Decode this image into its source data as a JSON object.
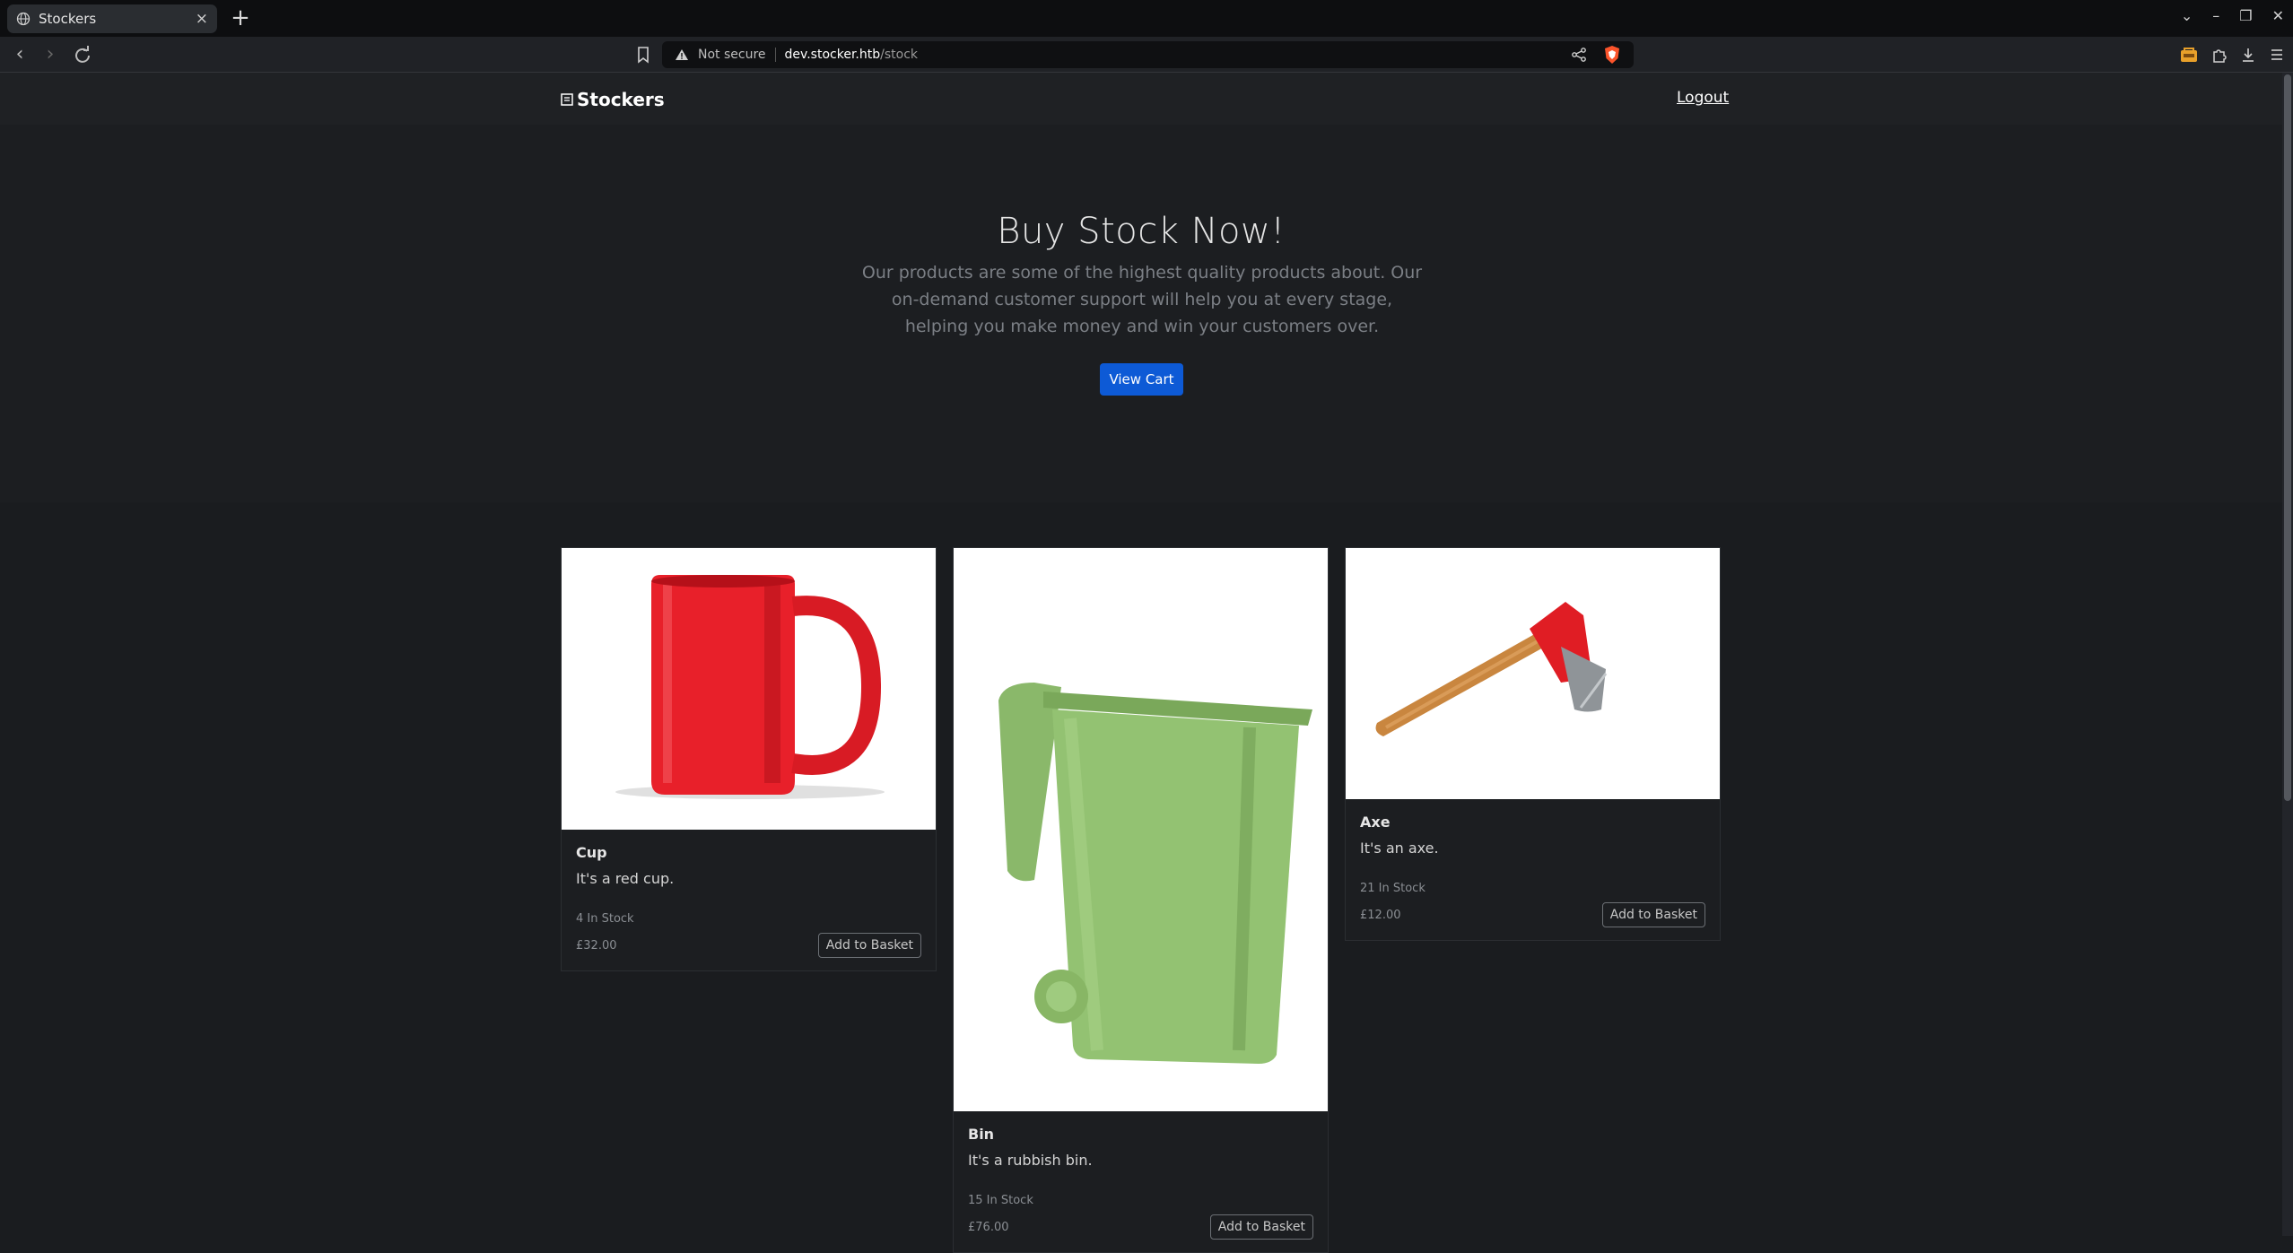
{
  "browser": {
    "tab_title": "Stockers",
    "tab_close": "×",
    "new_tab": "+",
    "url_security": "Not secure",
    "url_host": "dev.stocker.htb",
    "url_path": "/stock",
    "window_controls": [
      "⌄",
      "–",
      "❐",
      "✕"
    ]
  },
  "nav": {
    "brand": "Stockers",
    "logout": "Logout"
  },
  "hero": {
    "title": "Buy Stock Now!",
    "lead": "Our products are some of the highest quality products about. Our on-demand customer support will help you at every stage, helping you make money and win your customers over.",
    "button": "View Cart"
  },
  "products": [
    {
      "name": "Cup",
      "description": "It's a red cup.",
      "stock": "4 In Stock",
      "price": "£32.00",
      "button": "Add to Basket",
      "image": "red-mug"
    },
    {
      "name": "Bin",
      "description": "It's a rubbish bin.",
      "stock": "15 In Stock",
      "price": "£76.00",
      "button": "Add to Basket",
      "image": "green-bin"
    },
    {
      "name": "Axe",
      "description": "It's an axe.",
      "stock": "21 In Stock",
      "price": "£12.00",
      "button": "Add to Basket",
      "image": "red-axe"
    }
  ],
  "colors": {
    "primary_button": "#0d5ad6",
    "page_bg": "#1a1c1f"
  }
}
